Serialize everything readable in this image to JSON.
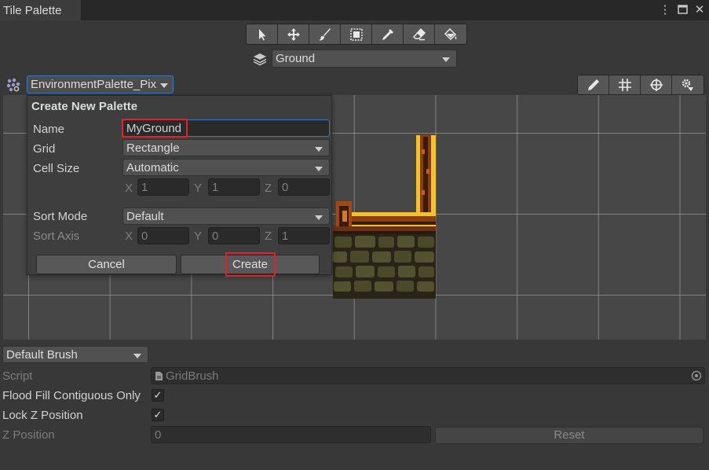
{
  "window": {
    "tab_title": "Tile Palette",
    "icons": [
      "more-icon",
      "maximize-icon",
      "close-icon"
    ]
  },
  "toolbar": {
    "tools": [
      "select-tool-icon",
      "move-tool-icon",
      "paint-brush-icon",
      "box-fill-icon",
      "picker-icon",
      "eraser-icon",
      "flood-fill-icon"
    ],
    "active_tilemap": "Ground"
  },
  "palette": {
    "selected": "EnvironmentPalette_Pix",
    "edit_tools": [
      "edit-pencil-icon",
      "grid-icon",
      "gizmo-icon",
      "settings-icon"
    ]
  },
  "create_palette": {
    "title": "Create New Palette",
    "name_label": "Name",
    "name_value": "MyGround",
    "grid_label": "Grid",
    "grid_value": "Rectangle",
    "cell_size_label": "Cell Size",
    "cell_size_value": "Automatic",
    "cell_x": "1",
    "cell_y": "1",
    "cell_z": "0",
    "sort_mode_label": "Sort Mode",
    "sort_mode_value": "Default",
    "sort_axis_label": "Sort Axis",
    "sort_x": "0",
    "sort_y": "0",
    "sort_z": "1",
    "axis_x": "X",
    "axis_y": "Y",
    "axis_z": "Z",
    "cancel_label": "Cancel",
    "create_label": "Create"
  },
  "inspector": {
    "brush": "Default Brush",
    "script_label": "Script",
    "script_value": "GridBrush",
    "flood_fill_label": "Flood Fill Contiguous Only",
    "flood_fill_checked": "✓",
    "lock_z_label": "Lock Z Position",
    "lock_z_checked": "✓",
    "z_position_label": "Z Position",
    "z_position_value": "0",
    "reset_label": "Reset"
  },
  "colors": {
    "highlight": "#e0202a",
    "focus": "#3a79bb"
  }
}
